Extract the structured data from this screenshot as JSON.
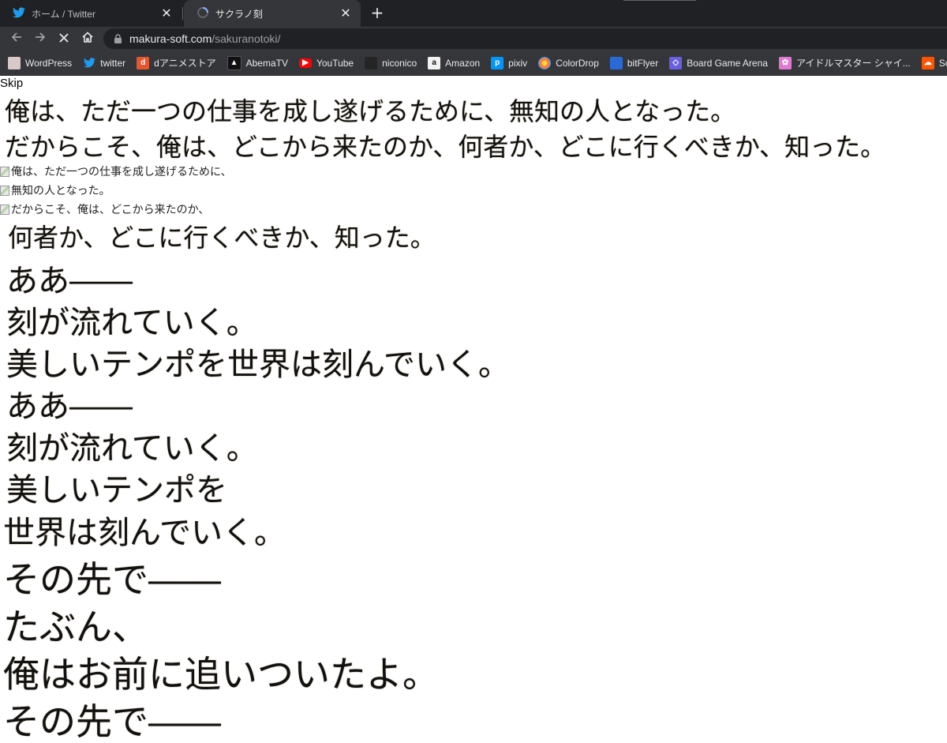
{
  "browser": {
    "tabs": [
      {
        "title": "ホーム / Twitter",
        "icon": "twitter-icon",
        "active": false
      },
      {
        "title": "サクラノ刻",
        "icon": "loading-spinner-icon",
        "active": true
      }
    ],
    "new_tab_symbol": "+",
    "close_symbol": "✕",
    "url_host": "makura-soft.com",
    "url_path": "/sakuranotoki/",
    "bookmarks": [
      {
        "label": "WordPress",
        "icon": "wordpress-icon",
        "color": "#d8c8c8"
      },
      {
        "label": "twitter",
        "icon": "twitter-icon",
        "color": "#1d9bf0"
      },
      {
        "label": "dアニメストア",
        "icon": "danime-store-icon",
        "color": "#e4572e"
      },
      {
        "label": "AbemaTV",
        "icon": "abematv-icon",
        "color": "#111111"
      },
      {
        "label": "YouTube",
        "icon": "youtube-icon",
        "color": "#ff0000"
      },
      {
        "label": "niconico",
        "icon": "niconico-icon",
        "color": "#252525"
      },
      {
        "label": "Amazon",
        "icon": "amazon-icon",
        "color": "#f2f2f2"
      },
      {
        "label": "pixiv",
        "icon": "pixiv-icon",
        "color": "#0096fa"
      },
      {
        "label": "ColorDrop",
        "icon": "colordrop-icon",
        "color": "#ff7a3d"
      },
      {
        "label": "bitFlyer",
        "icon": "bitflyer-icon",
        "color": "#2a6ad6"
      },
      {
        "label": "Board Game Arena",
        "icon": "board-game-arena-icon",
        "color": "#6a5fe0"
      },
      {
        "label": "アイドルマスター シャイ...",
        "icon": "idolmaster-icon",
        "color": "#e07ad0"
      },
      {
        "label": "SoundCloud",
        "icon": "soundcloud-icon",
        "color": "#ff5500"
      }
    ]
  },
  "page": {
    "skip_label": "Skip",
    "lines": [
      "俺は、ただ一つの仕事を成し遂げるために、無知の人となった。",
      "だからこそ、俺は、どこから来たのか、何者か、どこに行くべきか、知った。"
    ],
    "alt_lines": [
      "俺は、ただ一つの仕事を成し遂げるために、",
      "無知の人となった。",
      "だからこそ、俺は、どこから来たのか、"
    ],
    "lyrics": [
      "何者か、どこに行くべきか、知った。",
      "ああ――",
      "刻が流れていく。",
      "美しいテンポを世界は刻んでいく。",
      "ああ――",
      "刻が流れていく。",
      "美しいテンポを",
      "世界は刻んでいく。",
      "その先で――",
      "たぶん、",
      "俺はお前に追いついたよ。",
      "その先で――"
    ]
  }
}
